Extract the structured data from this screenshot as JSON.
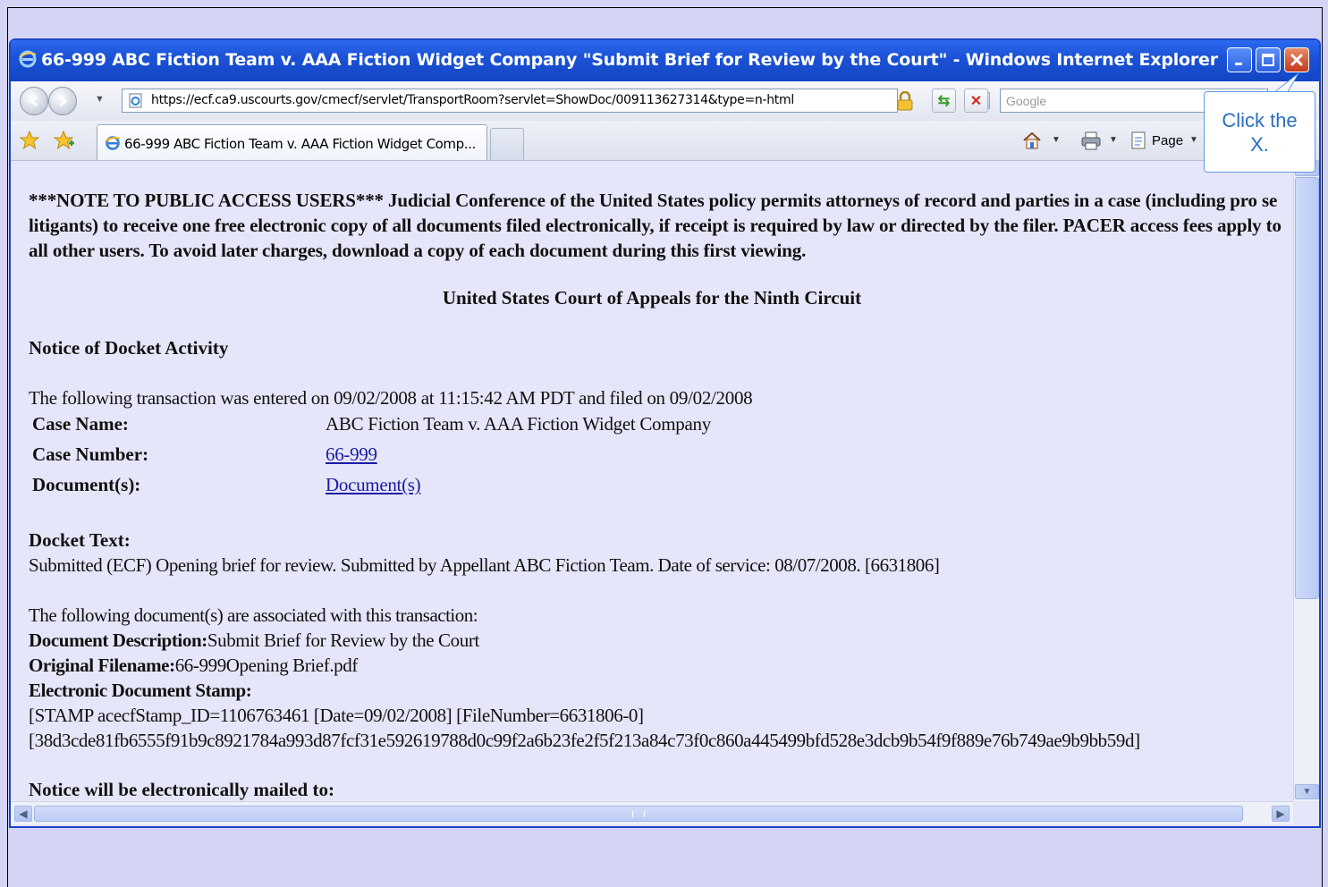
{
  "window": {
    "title": "66-999 ABC Fiction Team v. AAA Fiction Widget Company \"Submit Brief for Review by the Court\" - Windows Internet Explorer"
  },
  "navbar": {
    "url": "https://ecf.ca9.uscourts.gov/cmecf/servlet/TransportRoom?servlet=ShowDoc/009113627314&type=n-html",
    "search_placeholder": "Google"
  },
  "tabbar": {
    "tab_label": "66-999 ABC Fiction Team v. AAA Fiction Widget Comp...",
    "page_label": "Page"
  },
  "callout": {
    "line1": "Click the",
    "line2": "X."
  },
  "content": {
    "notice": "***NOTE TO PUBLIC ACCESS USERS*** Judicial Conference of the United States policy permits attorneys of record and parties in a case (including pro se litigants) to receive one free electronic copy of all documents filed electronically, if receipt is required by law or directed by the filer. PACER access fees apply to all other users. To avoid later charges, download a copy of each document during this first viewing.",
    "court_title": "United States Court of Appeals for the Ninth Circuit",
    "notice_heading": "Notice of Docket Activity",
    "transaction_line": "The following transaction was entered on 09/02/2008 at 11:15:42 AM PDT and filed on 09/02/2008",
    "case_name_label": "Case Name:",
    "case_name_value": "ABC Fiction Team v. AAA Fiction Widget Company",
    "case_number_label": "Case Number:",
    "case_number_value": "66-999",
    "documents_label": "Document(s):",
    "documents_value": "Document(s)",
    "docket_text_label": "Docket Text:",
    "docket_text": "Submitted (ECF) Opening brief for review. Submitted by Appellant ABC Fiction Team. Date of service: 08/07/2008. [6631806]",
    "assoc_line": "The following document(s) are associated with this transaction:",
    "doc_desc_label": "Document Description:",
    "doc_desc_value": "Submit Brief for Review by the Court",
    "orig_filename_label": "Original Filename:",
    "orig_filename_value": "66-999Opening Brief.pdf",
    "stamp_label": "Electronic Document Stamp:",
    "stamp_line1": "[STAMP acecfStamp_ID=1106763461 [Date=09/02/2008] [FileNumber=6631806-0]",
    "stamp_line2": "[38d3cde81fb6555f91b9c8921784a993d87fcf31e592619788d0c99f2a6b23fe2f5f213a84c73f0c860a445499bfd528e3dcb9b54f9f889e76b749ae9b9bb59d]",
    "mailed_label": "Notice will be electronically mailed to:"
  },
  "colors": {
    "titlebar": "#1c52d6",
    "background": "#e6e6fa",
    "link": "#1a1aa8",
    "callout_text": "#2b6fc0"
  }
}
